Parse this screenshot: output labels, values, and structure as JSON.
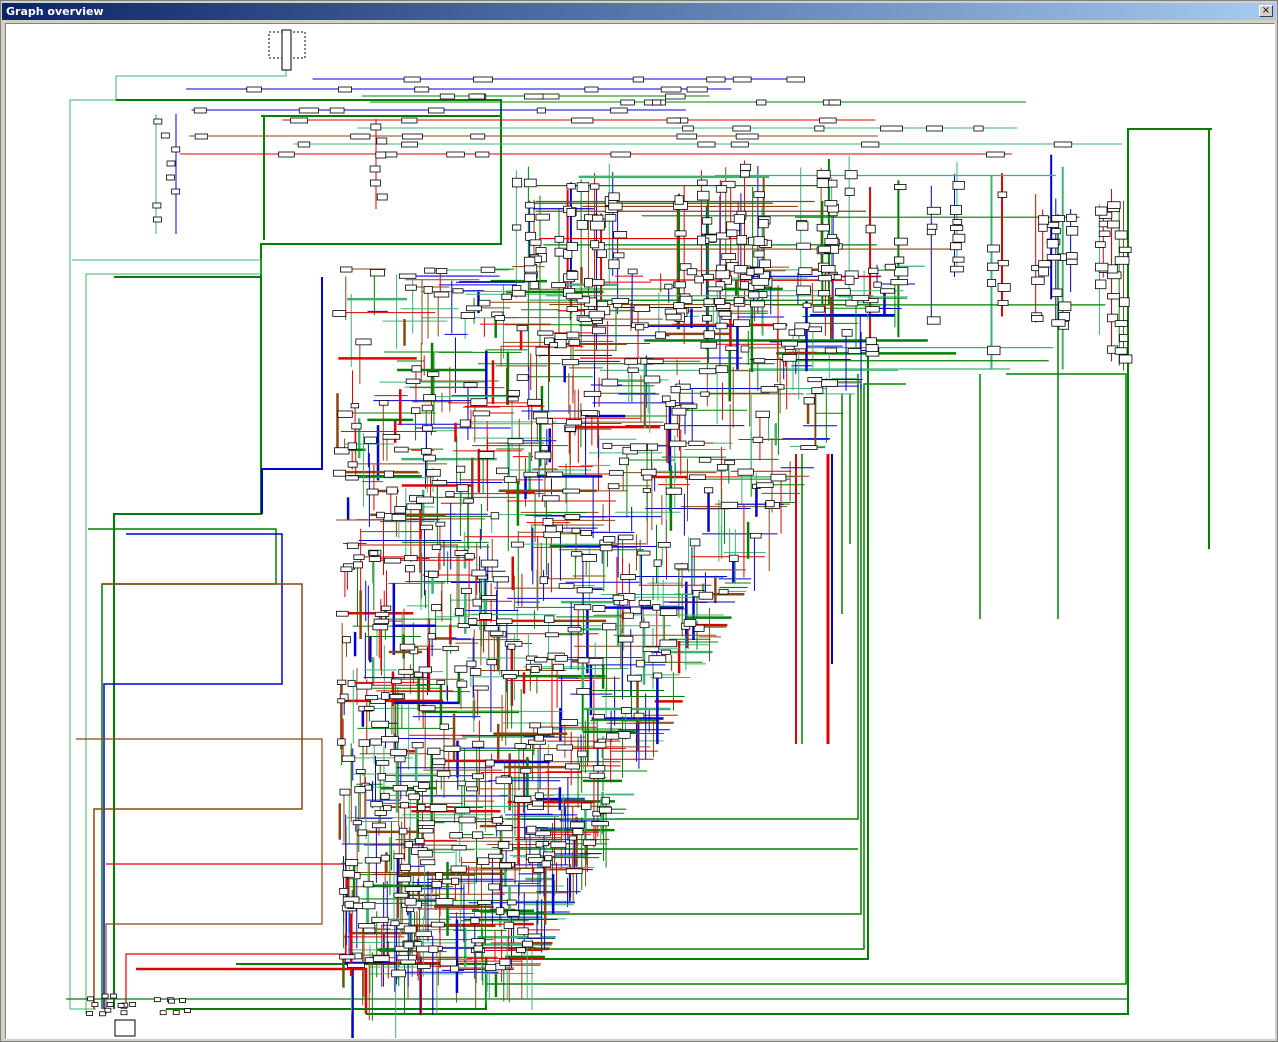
{
  "window": {
    "title": "Graph overview",
    "close_glyph": "×",
    "close_icon": "close-icon"
  },
  "graph": {
    "kind": "control-flow graph overview",
    "edge_colors": {
      "normal": "#008000",
      "normal_light": "#3cb371",
      "branch_taken": "#e00000",
      "branch_not_taken": "#0000d0",
      "other": "#8b4513"
    },
    "node_fill": "#ffffff",
    "node_border": "#000000",
    "viewport_marker": "dotted rectangle near top"
  }
}
